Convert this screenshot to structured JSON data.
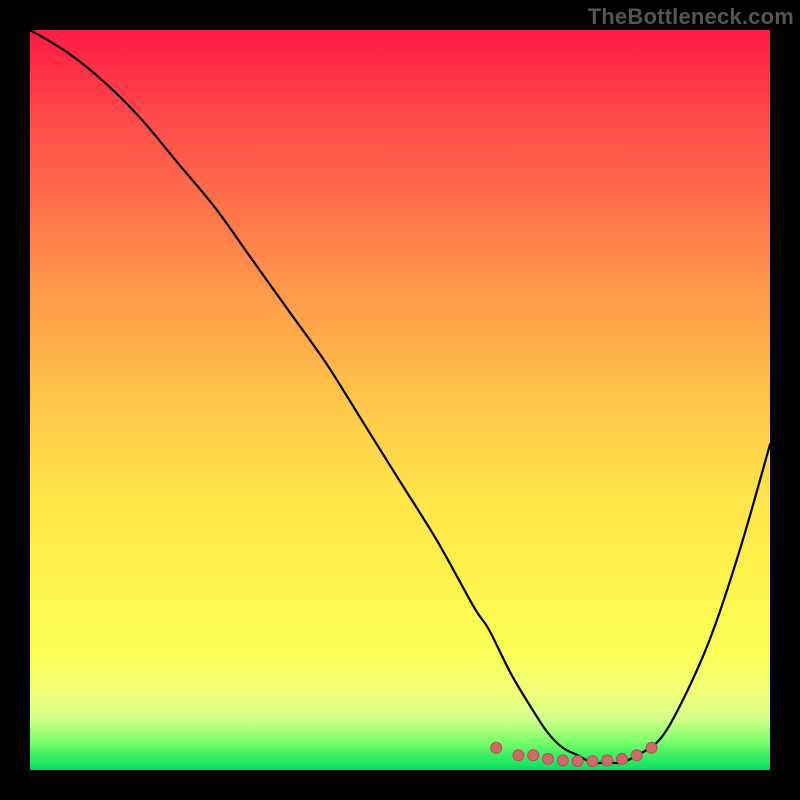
{
  "watermark": "TheBottleneck.com",
  "colors": {
    "top": "#ff1a45",
    "mid": "#ffe24a",
    "bottom": "#00e060",
    "curve": "#000000",
    "marker_fill": "#d06a6a",
    "marker_stroke": "#b84f4f"
  },
  "chart_data": {
    "type": "line",
    "title": "",
    "xlabel": "",
    "ylabel": "",
    "xlim": [
      0,
      100
    ],
    "ylim": [
      0,
      100
    ],
    "grid": false,
    "legend": false,
    "series": [
      {
        "name": "bottleneck-curve",
        "x": [
          0,
          5,
          10,
          15,
          20,
          25,
          30,
          35,
          40,
          45,
          50,
          55,
          60,
          62,
          65,
          68,
          70,
          72,
          74,
          76,
          78,
          80,
          82,
          85,
          88,
          92,
          96,
          100
        ],
        "y": [
          100,
          97,
          93,
          88,
          82,
          76,
          69,
          62,
          55,
          47,
          39,
          31,
          22,
          19,
          13,
          8,
          5,
          3,
          2,
          1,
          1,
          1,
          2,
          4,
          9,
          18,
          30,
          44
        ]
      }
    ],
    "markers": {
      "name": "plateau-markers",
      "x": [
        63,
        66,
        68,
        70,
        72,
        74,
        76,
        78,
        80,
        82,
        84
      ],
      "y": [
        3,
        2,
        2,
        1.5,
        1.3,
        1.2,
        1.2,
        1.3,
        1.5,
        2,
        3
      ]
    }
  }
}
